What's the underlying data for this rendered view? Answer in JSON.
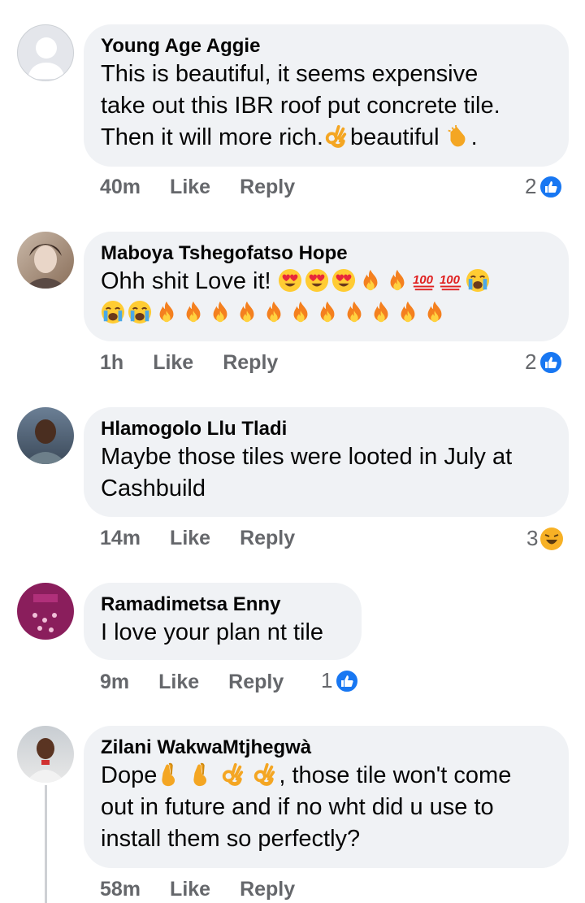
{
  "comments": [
    {
      "author": "Young Age Aggie",
      "line1": "This is beautiful, it seems expensive",
      "line2": "take out this IBR roof put concrete tile.",
      "line3a": "Then it will more rich.",
      "line3b": "beautiful",
      "line3c": ".",
      "time": "40m",
      "like": "Like",
      "reply": "Reply",
      "reaction_count": "2",
      "reaction_icon": "like-icon"
    },
    {
      "author": "Maboya Tshegofatso Hope",
      "line1": "Ohh shit Love it!",
      "time": "1h",
      "like": "Like",
      "reply": "Reply",
      "reaction_count": "2",
      "reaction_icon": "like-icon"
    },
    {
      "author": "Hlamogolo Llu Tladi",
      "line1": "Maybe those tiles were looted in July at",
      "line2": "Cashbuild",
      "time": "14m",
      "like": "Like",
      "reply": "Reply",
      "reaction_count": "3",
      "reaction_icon": "haha-icon"
    },
    {
      "author": "Ramadimetsa Enny",
      "line1": "I love your plan nt tile",
      "time": "9m",
      "like": "Like",
      "reply": "Reply",
      "reaction_count": "1",
      "reaction_icon": "like-icon"
    },
    {
      "author": "Zilani WakwaMtjhegwà",
      "line1a": "Dope",
      "line1b": ", those tile won't come",
      "line2": "out in future and if no wht did u use to",
      "line3": "install them so perfectly?",
      "time": "58m",
      "like": "Like",
      "reply": "Reply"
    }
  ],
  "colors": {
    "bubble": "#f0f2f5",
    "meta_text": "#65676b",
    "like_blue": "#1877f2",
    "haha_yellow": "#f7b125"
  }
}
